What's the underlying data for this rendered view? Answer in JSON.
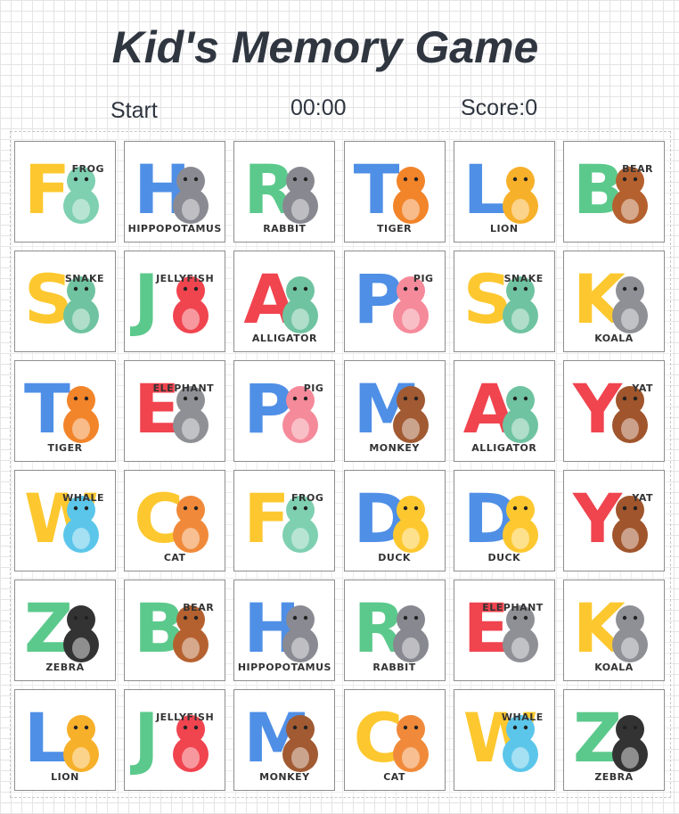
{
  "title": "Kid's Memory Game",
  "status": {
    "start_label": "Start",
    "timer": "00:00",
    "score_label": "Score:0"
  },
  "cards": [
    {
      "letter": "F",
      "name": "FROG",
      "letter_color": "#fdc82f",
      "animal_color": "#7ed0b0",
      "name_pos": "top"
    },
    {
      "letter": "H",
      "name": "HIPPOPOTAMUS",
      "letter_color": "#4f8fe6",
      "animal_color": "#8a8a92",
      "name_pos": "bottom"
    },
    {
      "letter": "R",
      "name": "RABBIT",
      "letter_color": "#5cc98c",
      "animal_color": "#888890",
      "name_pos": "bottom"
    },
    {
      "letter": "T",
      "name": "TIGER",
      "letter_color": "#4f8fe6",
      "animal_color": "#f2842a",
      "name_pos": "bottom"
    },
    {
      "letter": "L",
      "name": "LION",
      "letter_color": "#4f8fe6",
      "animal_color": "#f7b02a",
      "name_pos": "bottom"
    },
    {
      "letter": "B",
      "name": "BEAR",
      "letter_color": "#5cc98c",
      "animal_color": "#b5612f",
      "name_pos": "top"
    },
    {
      "letter": "S",
      "name": "SNAKE",
      "letter_color": "#fdc82f",
      "animal_color": "#6fc3a0",
      "name_pos": "top"
    },
    {
      "letter": "J",
      "name": "JELLYFISH",
      "letter_color": "#5cc98c",
      "animal_color": "#f0444f",
      "name_pos": "top"
    },
    {
      "letter": "A",
      "name": "ALLIGATOR",
      "letter_color": "#f0444f",
      "animal_color": "#6fc3a0",
      "name_pos": "bottom"
    },
    {
      "letter": "P",
      "name": "PIG",
      "letter_color": "#4f8fe6",
      "animal_color": "#f58a9a",
      "name_pos": "top"
    },
    {
      "letter": "S",
      "name": "SNAKE",
      "letter_color": "#fdc82f",
      "animal_color": "#6fc3a0",
      "name_pos": "top"
    },
    {
      "letter": "K",
      "name": "KOALA",
      "letter_color": "#fdc82f",
      "animal_color": "#8e9096",
      "name_pos": "bottom"
    },
    {
      "letter": "T",
      "name": "TIGER",
      "letter_color": "#4f8fe6",
      "animal_color": "#f2842a",
      "name_pos": "bottom"
    },
    {
      "letter": "E",
      "name": "ELEPHANT",
      "letter_color": "#f0444f",
      "animal_color": "#8e9096",
      "name_pos": "top"
    },
    {
      "letter": "P",
      "name": "PIG",
      "letter_color": "#4f8fe6",
      "animal_color": "#f58a9a",
      "name_pos": "top"
    },
    {
      "letter": "M",
      "name": "MONKEY",
      "letter_color": "#4f8fe6",
      "animal_color": "#a15a32",
      "name_pos": "bottom"
    },
    {
      "letter": "A",
      "name": "ALLIGATOR",
      "letter_color": "#f0444f",
      "animal_color": "#6fc3a0",
      "name_pos": "bottom"
    },
    {
      "letter": "Y",
      "name": "YAT",
      "letter_color": "#f0444f",
      "animal_color": "#a0552c",
      "name_pos": "top"
    },
    {
      "letter": "W",
      "name": "WHALE",
      "letter_color": "#fdc82f",
      "animal_color": "#5cc6ea",
      "name_pos": "top"
    },
    {
      "letter": "C",
      "name": "CAT",
      "letter_color": "#fdc82f",
      "animal_color": "#f08a3a",
      "name_pos": "bottom"
    },
    {
      "letter": "F",
      "name": "FROG",
      "letter_color": "#fdc82f",
      "animal_color": "#7ed0b0",
      "name_pos": "top"
    },
    {
      "letter": "D",
      "name": "DUCK",
      "letter_color": "#4f8fe6",
      "animal_color": "#fdc82f",
      "name_pos": "bottom"
    },
    {
      "letter": "D",
      "name": "DUCK",
      "letter_color": "#4f8fe6",
      "animal_color": "#fdc82f",
      "name_pos": "bottom"
    },
    {
      "letter": "Y",
      "name": "YAT",
      "letter_color": "#f0444f",
      "animal_color": "#a0552c",
      "name_pos": "top"
    },
    {
      "letter": "Z",
      "name": "ZEBRA",
      "letter_color": "#5cc98c",
      "animal_color": "#333333",
      "name_pos": "bottom"
    },
    {
      "letter": "B",
      "name": "BEAR",
      "letter_color": "#5cc98c",
      "animal_color": "#b5612f",
      "name_pos": "top"
    },
    {
      "letter": "H",
      "name": "HIPPOPOTAMUS",
      "letter_color": "#4f8fe6",
      "animal_color": "#8a8a92",
      "name_pos": "bottom"
    },
    {
      "letter": "R",
      "name": "RABBIT",
      "letter_color": "#5cc98c",
      "animal_color": "#888890",
      "name_pos": "bottom"
    },
    {
      "letter": "E",
      "name": "ELEPHANT",
      "letter_color": "#f0444f",
      "animal_color": "#8e9096",
      "name_pos": "top"
    },
    {
      "letter": "K",
      "name": "KOALA",
      "letter_color": "#fdc82f",
      "animal_color": "#8e9096",
      "name_pos": "bottom"
    },
    {
      "letter": "L",
      "name": "LION",
      "letter_color": "#4f8fe6",
      "animal_color": "#f7b02a",
      "name_pos": "bottom"
    },
    {
      "letter": "J",
      "name": "JELLYFISH",
      "letter_color": "#5cc98c",
      "animal_color": "#f0444f",
      "name_pos": "top"
    },
    {
      "letter": "M",
      "name": "MONKEY",
      "letter_color": "#4f8fe6",
      "animal_color": "#a15a32",
      "name_pos": "bottom"
    },
    {
      "letter": "C",
      "name": "CAT",
      "letter_color": "#fdc82f",
      "animal_color": "#f08a3a",
      "name_pos": "bottom"
    },
    {
      "letter": "W",
      "name": "WHALE",
      "letter_color": "#fdc82f",
      "animal_color": "#5cc6ea",
      "name_pos": "top"
    },
    {
      "letter": "Z",
      "name": "ZEBRA",
      "letter_color": "#5cc98c",
      "animal_color": "#333333",
      "name_pos": "bottom"
    }
  ]
}
